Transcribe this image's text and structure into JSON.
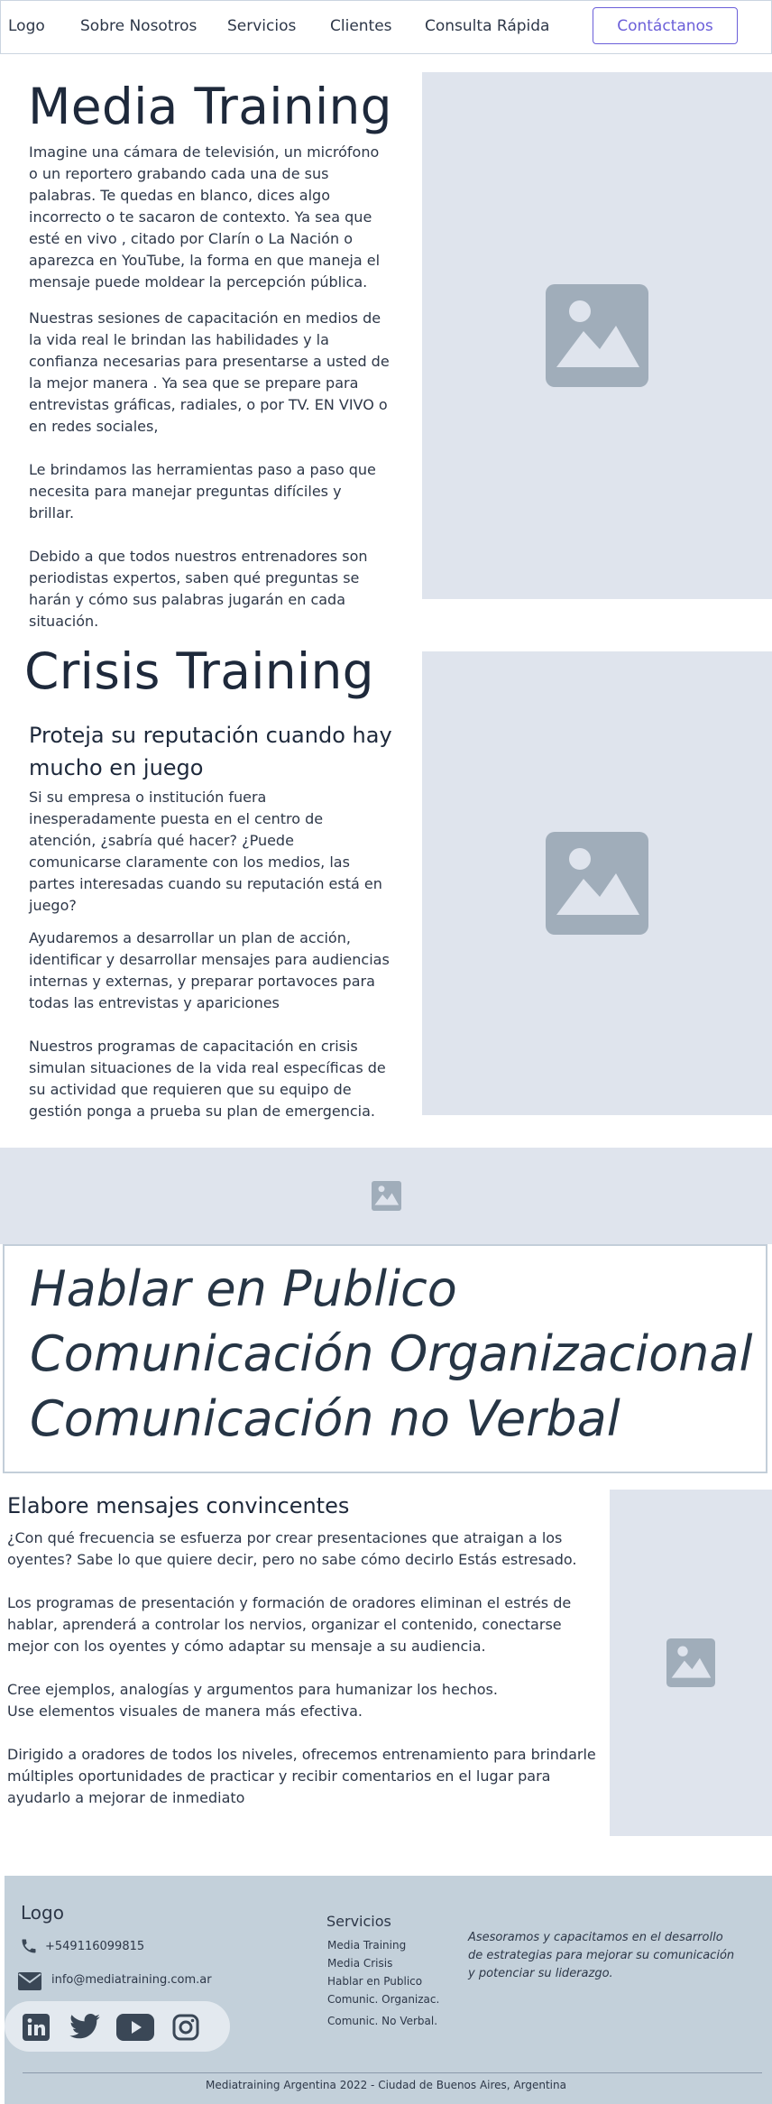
{
  "nav": {
    "logo": "Logo",
    "items": [
      "Sobre Nosotros",
      "Servicios",
      "Clientes",
      "Consulta Rápida"
    ],
    "cta": "Contáctanos",
    "accent": "#6b5fd9"
  },
  "media": {
    "title": "Media Training",
    "paragraphs": [
      "Imagine una cámara de televisión, un micrófono o un reportero grabando cada una de sus palabras. Te quedas en blanco, dices algo incorrecto o te sacaron de contexto. Ya sea que esté en vivo , citado por Clarín o La Nación o aparezca en YouTube, la forma en que maneja el mensaje puede moldear la percepción pública.",
      "Nuestras sesiones de capacitación en medios de la vida real le brindan las habilidades y la confianza necesarias para presentarse a usted de la mejor manera . Ya sea que se prepare para entrevistas gráficas, radiales, o por TV.  EN VIVO o en redes sociales,",
      "Le brindamos las herramientas paso a paso que necesita para manejar preguntas difíciles y brillar.",
      "Debido a que todos nuestros entrenadores son periodistas expertos, saben qué preguntas se harán y cómo sus palabras jugarán en cada situación."
    ]
  },
  "crisis": {
    "title": "Crisis Training",
    "subtitle": "Proteja su reputación cuando hay mucho en juego",
    "paragraphs": [
      "Si su empresa o institución fuera inesperadamente puesta en el centro de atención, ¿sabría qué hacer? ¿Puede comunicarse claramente con los medios, las partes interesadas cuando su reputación está en juego?",
      "Ayudaremos a desarrollar un plan de acción, identificar y desarrollar mensajes para audiencias internas y externas,  y preparar portavoces para todas las entrevistas y apariciones",
      "Nuestros programas de capacitación en crisis simulan situaciones de la vida real específicas de su actividad que requieren que su equipo de gestión ponga a prueba su plan de emergencia."
    ]
  },
  "banner": {
    "lines": [
      "Hablar en Publico",
      "Comunicación Organizacional",
      "Comunicación no Verbal"
    ]
  },
  "speak": {
    "title": "Elabore mensajes convincentes",
    "paragraphs": [
      "¿Con qué frecuencia se esfuerza por crear presentaciones que atraigan a los oyentes? Sabe lo que quiere decir, pero no sabe cómo decirlo  Estás estresado.",
      "Los programas de presentación y formación de oradores eliminan el estrés de hablar, aprenderá a controlar los nervios, organizar el contenido, conectarse mejor con los oyentes y cómo adaptar su mensaje a su audiencia.",
      "Cree ejemplos, analogías y argumentos para humanizar los hechos.",
      "Use elementos visuales de manera más efectiva.",
      "Dirigido a oradores de todos los niveles, ofrecemos entrenamiento para brindarle múltiples oportunidades de practicar y recibir comentarios en el lugar para ayudarlo a mejorar de inmediato"
    ]
  },
  "footer": {
    "logo": "Logo",
    "phone": "+549116099815",
    "email": "info@mediatraining.com.ar",
    "services_title": "Servicios",
    "services": [
      "Media Training",
      "Media Crisis",
      "Hablar en Publico",
      "Comunic. Organizac.",
      "Comunic. No Verbal."
    ],
    "tagline": "Asesoramos y capacitamos en el desarrollo de estrategias para mejorar su comunicación y potenciar su liderazgo.",
    "copyright": "Mediatraining Argentina 2022 -  Ciudad de Buenos Aires, Argentina",
    "social_icons": [
      "linkedin-icon",
      "twitter-icon",
      "youtube-icon",
      "instagram-icon"
    ]
  }
}
